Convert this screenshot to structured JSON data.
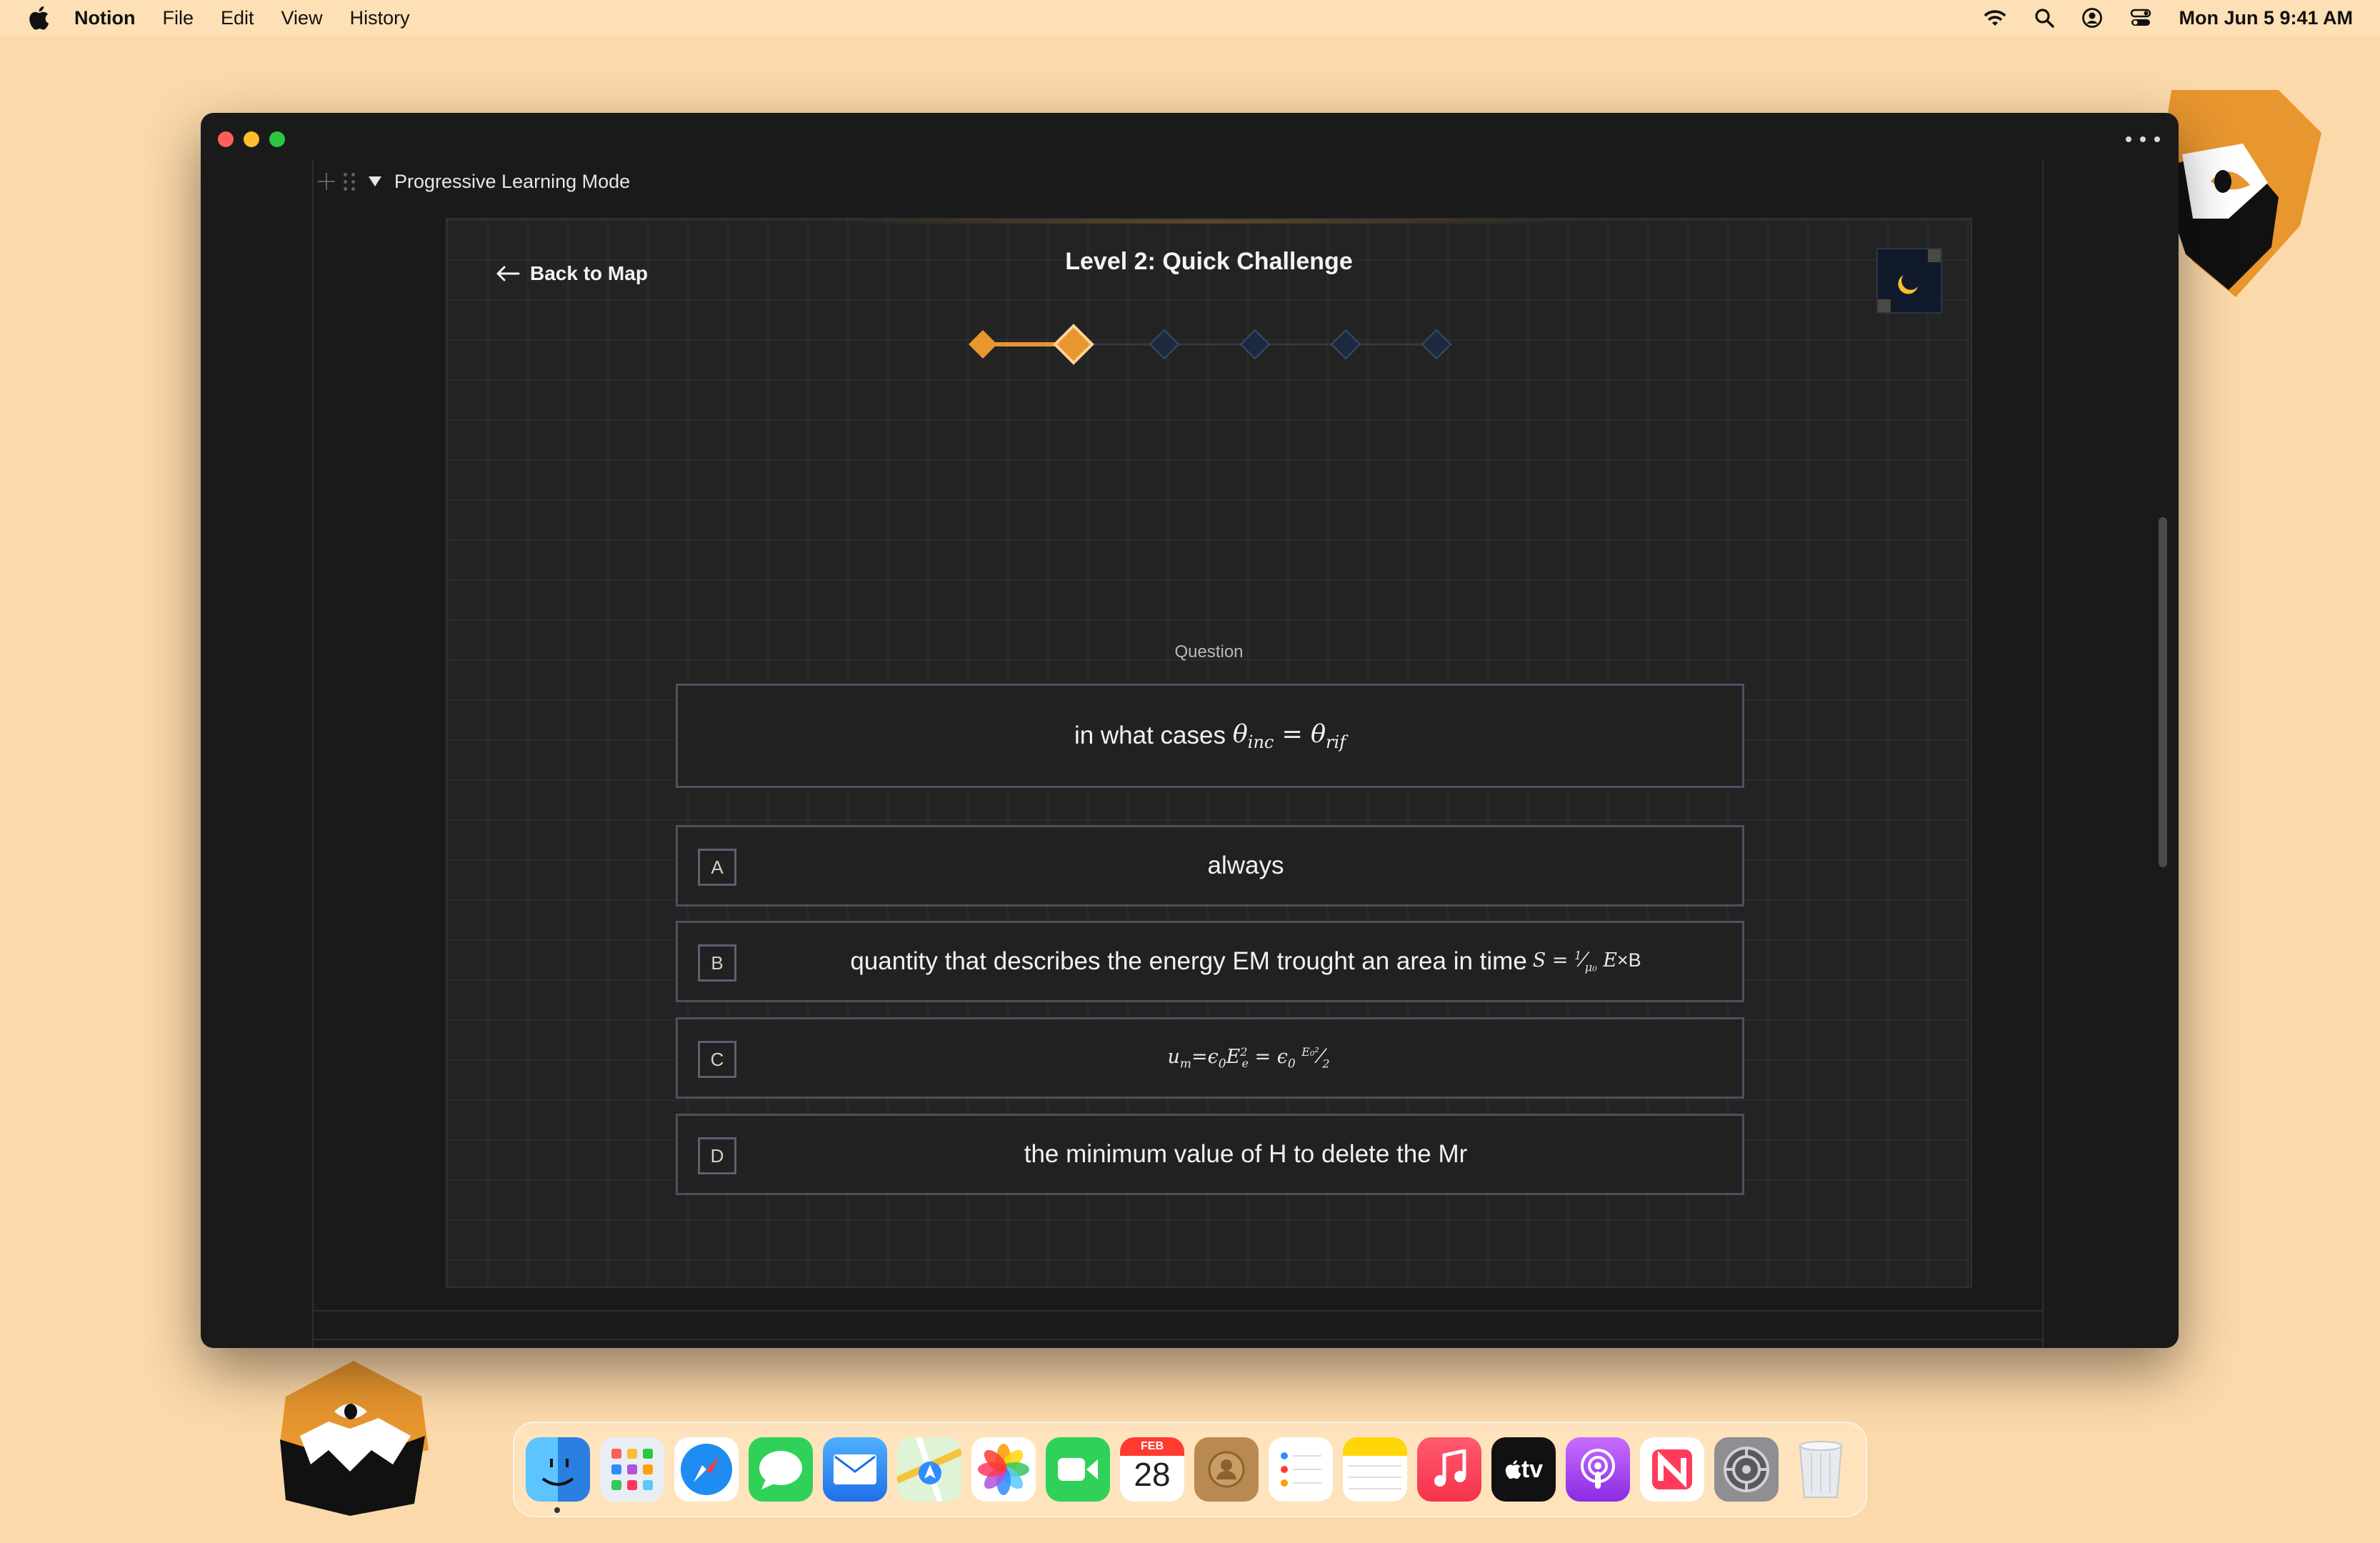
{
  "menubar": {
    "app_name": "Notion",
    "menus": [
      "File",
      "Edit",
      "View",
      "History"
    ],
    "clock": "Mon Jun 5  9:41 AM"
  },
  "page": {
    "toggle_title": "Progressive Learning Mode"
  },
  "game": {
    "back_label": "Back to Map",
    "level_title": "Level 2: Quick Challenge",
    "progress": {
      "total_levels": 6,
      "completed": 1,
      "current": 2
    },
    "colors": {
      "accent": "#e8962e",
      "locked": "#1c2a40",
      "locked_border": "#3a4a66"
    },
    "question_label": "Question",
    "question_text": "in what cases ",
    "question_math": "θinc = θrif",
    "options": [
      {
        "letter": "A",
        "text": "always",
        "math": ""
      },
      {
        "letter": "B",
        "text": "quantity that describes the energy EM trought an area in time",
        "math": "S = 1/μ₀ E×B"
      },
      {
        "letter": "C",
        "text": "",
        "math": "um=ϵ₀E²e = ϵ₀ E²₀/2"
      },
      {
        "letter": "D",
        "text": "the minimum value of H to delete the Mr",
        "math": ""
      }
    ]
  },
  "dock": {
    "calendar_month": "FEB",
    "calendar_day": "28",
    "tv_label": "tv"
  }
}
